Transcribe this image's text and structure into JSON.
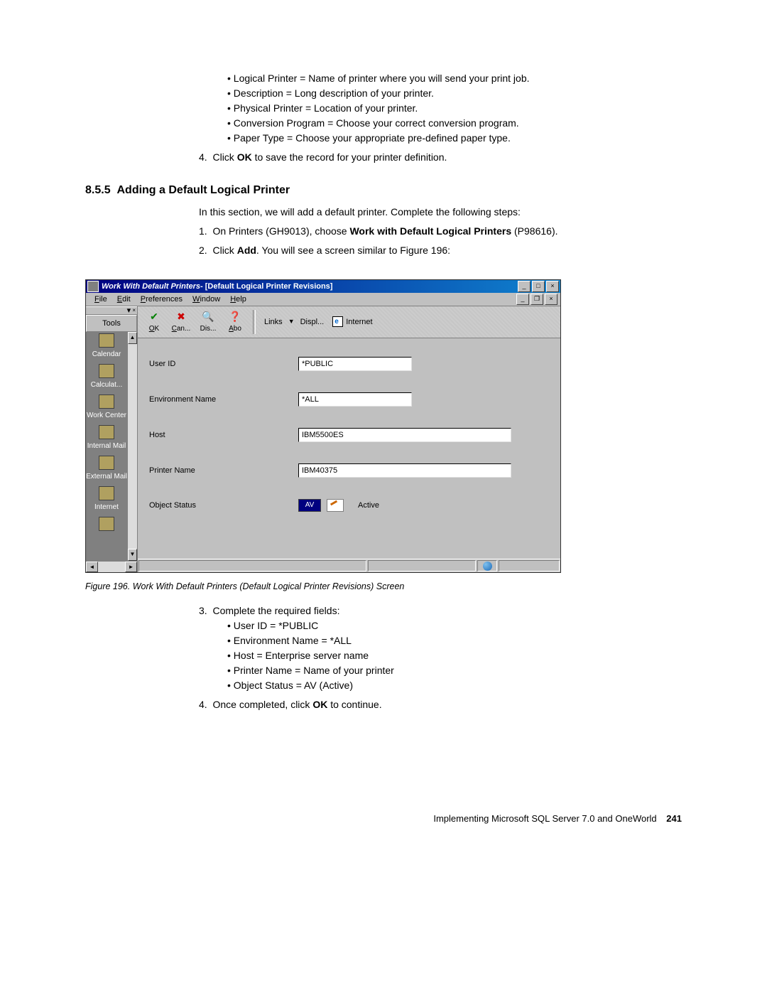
{
  "top_bullets": [
    "Logical Printer = Name of printer where you will send your print job.",
    "Description = Long description of your printer.",
    "Physical Printer = Location of your printer.",
    "Conversion Program = Choose your correct conversion program.",
    "Paper Type = Choose your appropriate pre-defined paper type."
  ],
  "top_step4_pre": "Click ",
  "top_step4_b": "OK",
  "top_step4_post": " to save the record for your printer definition.",
  "section_no": "8.5.5",
  "section_title": "Adding a Default Logical Printer",
  "intro": "In this section, we will add a default printer. Complete the following steps:",
  "s1_pre": "On Printers (GH9013), choose ",
  "s1_b": "Work with Default Logical Printers",
  "s1_post": " (P98616).",
  "s2_pre": "Click ",
  "s2_b": "Add",
  "s2_post": ". You will see a screen similar to Figure 196:",
  "window": {
    "title_italic": "Work With Default Printers",
    "title_sub": " - [Default Logical Printer Revisions]",
    "menus": {
      "file": "File",
      "edit": "Edit",
      "prefs": "Preferences",
      "window": "Window",
      "help": "Help"
    },
    "tools_label": "Tools",
    "side": [
      "Calendar",
      "Calculat...",
      "Work Center",
      "Internal Mail",
      "External Mail",
      "Internet",
      ""
    ],
    "tb": {
      "ok": "OK",
      "can": "Can...",
      "dis": "Dis...",
      "abo": "Abo"
    },
    "links_lbl": "Links",
    "displ": "Displ...",
    "internet": "Internet",
    "labels": {
      "user": "User ID",
      "env": "Environment Name",
      "host": "Host",
      "printer": "Printer Name",
      "status": "Object Status"
    },
    "values": {
      "user": "*PUBLIC",
      "env": "*ALL",
      "host": "IBM5500ES",
      "printer": "IBM40375",
      "status_code": "AV",
      "status_text": "Active"
    }
  },
  "figcap": "Figure 196.  Work With Default Printers (Default Logical Printer Revisions) Screen",
  "step3_lead": "Complete the required fields:",
  "step3_bullets": [
    "User ID = *PUBLIC",
    "Environment Name = *ALL",
    "Host = Enterprise server name",
    "Printer Name = Name of your printer",
    "Object Status = AV (Active)"
  ],
  "step4_pre": "Once completed, click ",
  "step4_b": "OK",
  "step4_post": " to continue.",
  "footer_text": "Implementing Microsoft SQL Server 7.0 and OneWorld",
  "footer_page": "241"
}
